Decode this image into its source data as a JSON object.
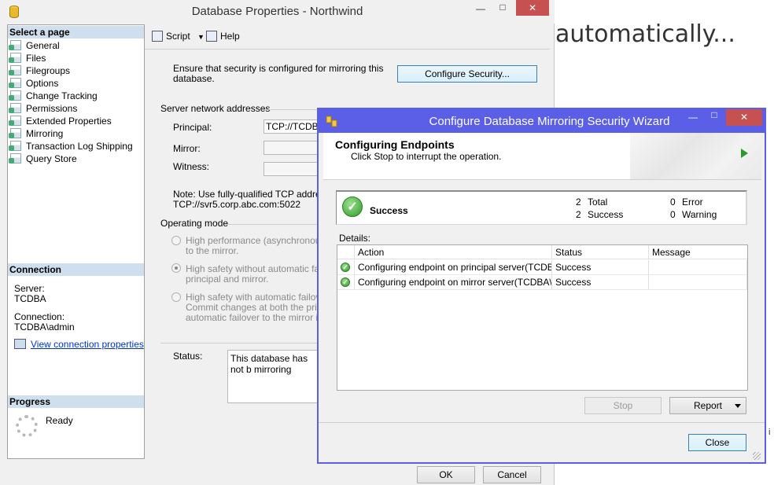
{
  "background_page": {
    "heading": "automatically...",
    "fragment": "i"
  },
  "db_window": {
    "title": "Database Properties - Northwind",
    "caption": {
      "minimize": "—",
      "maximize": "□",
      "close": "✕"
    },
    "select_page": {
      "header": "Select a page",
      "items": [
        "General",
        "Files",
        "Filegroups",
        "Options",
        "Change Tracking",
        "Permissions",
        "Extended Properties",
        "Mirroring",
        "Transaction Log Shipping",
        "Query Store"
      ]
    },
    "connection": {
      "header": "Connection",
      "server_label": "Server:",
      "server_value": "TCDBA",
      "connection_label": "Connection:",
      "connection_value": "TCDBA\\admin",
      "link": "View connection properties"
    },
    "progress": {
      "header": "Progress",
      "status": "Ready"
    },
    "toolbar": {
      "script": "Script",
      "help": "Help"
    },
    "mirroring": {
      "security_note_line1": "Ensure that security is configured for mirroring this",
      "security_note_line2": "database.",
      "configure_security_button": "Configure Security...",
      "server_addresses_header": "Server network addresses",
      "principal_label": "Principal:",
      "principal_value": "TCP://TCDBA",
      "mirror_label": "Mirror:",
      "mirror_value": "",
      "witness_label": "Witness:",
      "witness_value": "",
      "note_line1": "Note: Use fully-qualified TCP addresses",
      "note_line2": "TCP://svr5.corp.abc.com:5022",
      "operating_mode_header": "Operating mode",
      "modes": [
        {
          "line1": "High performance (asynchronous) -",
          "line2": "to the mirror.",
          "selected": false
        },
        {
          "line1": "High safety without automatic failov",
          "line2": "principal and mirror.",
          "selected": true
        },
        {
          "line1": "High safety with automatic failover (",
          "line2": "Commit changes at both the princip",
          "line3": "automatic failover to the mirror if the",
          "selected": false
        }
      ],
      "status_label": "Status:",
      "status_text": "This database has not b mirroring"
    },
    "ok_button": "OK",
    "cancel_button": "Cancel"
  },
  "wizard": {
    "title": "Configure Database Mirroring Security Wizard",
    "caption": {
      "minimize": "—",
      "maximize": "□",
      "close": "✕"
    },
    "banner_title": "Configuring Endpoints",
    "banner_subtitle": "Click Stop to interrupt the operation.",
    "summary": {
      "status": "Success",
      "total_count": "2",
      "total_label": "Total",
      "success_count": "2",
      "success_label": "Success",
      "error_count": "0",
      "error_label": "Error",
      "warning_count": "0",
      "warning_label": "Warning"
    },
    "details_label": "Details:",
    "grid": {
      "columns": [
        "Action",
        "Status",
        "Message"
      ],
      "rows": [
        {
          "action": "Configuring endpoint on principal server(TCDBA)",
          "status": "Success",
          "message": ""
        },
        {
          "action": "Configuring endpoint on mirror server(TCDBA\\S...",
          "status": "Success",
          "message": ""
        }
      ]
    },
    "stop_button": "Stop",
    "report_button": "Report",
    "close_button": "Close"
  },
  "colors": {
    "wizard_frame": "#5b5ee6",
    "close_red": "#c75050",
    "section_header": "#cfdfee",
    "success_green": "#2f9b2a"
  }
}
